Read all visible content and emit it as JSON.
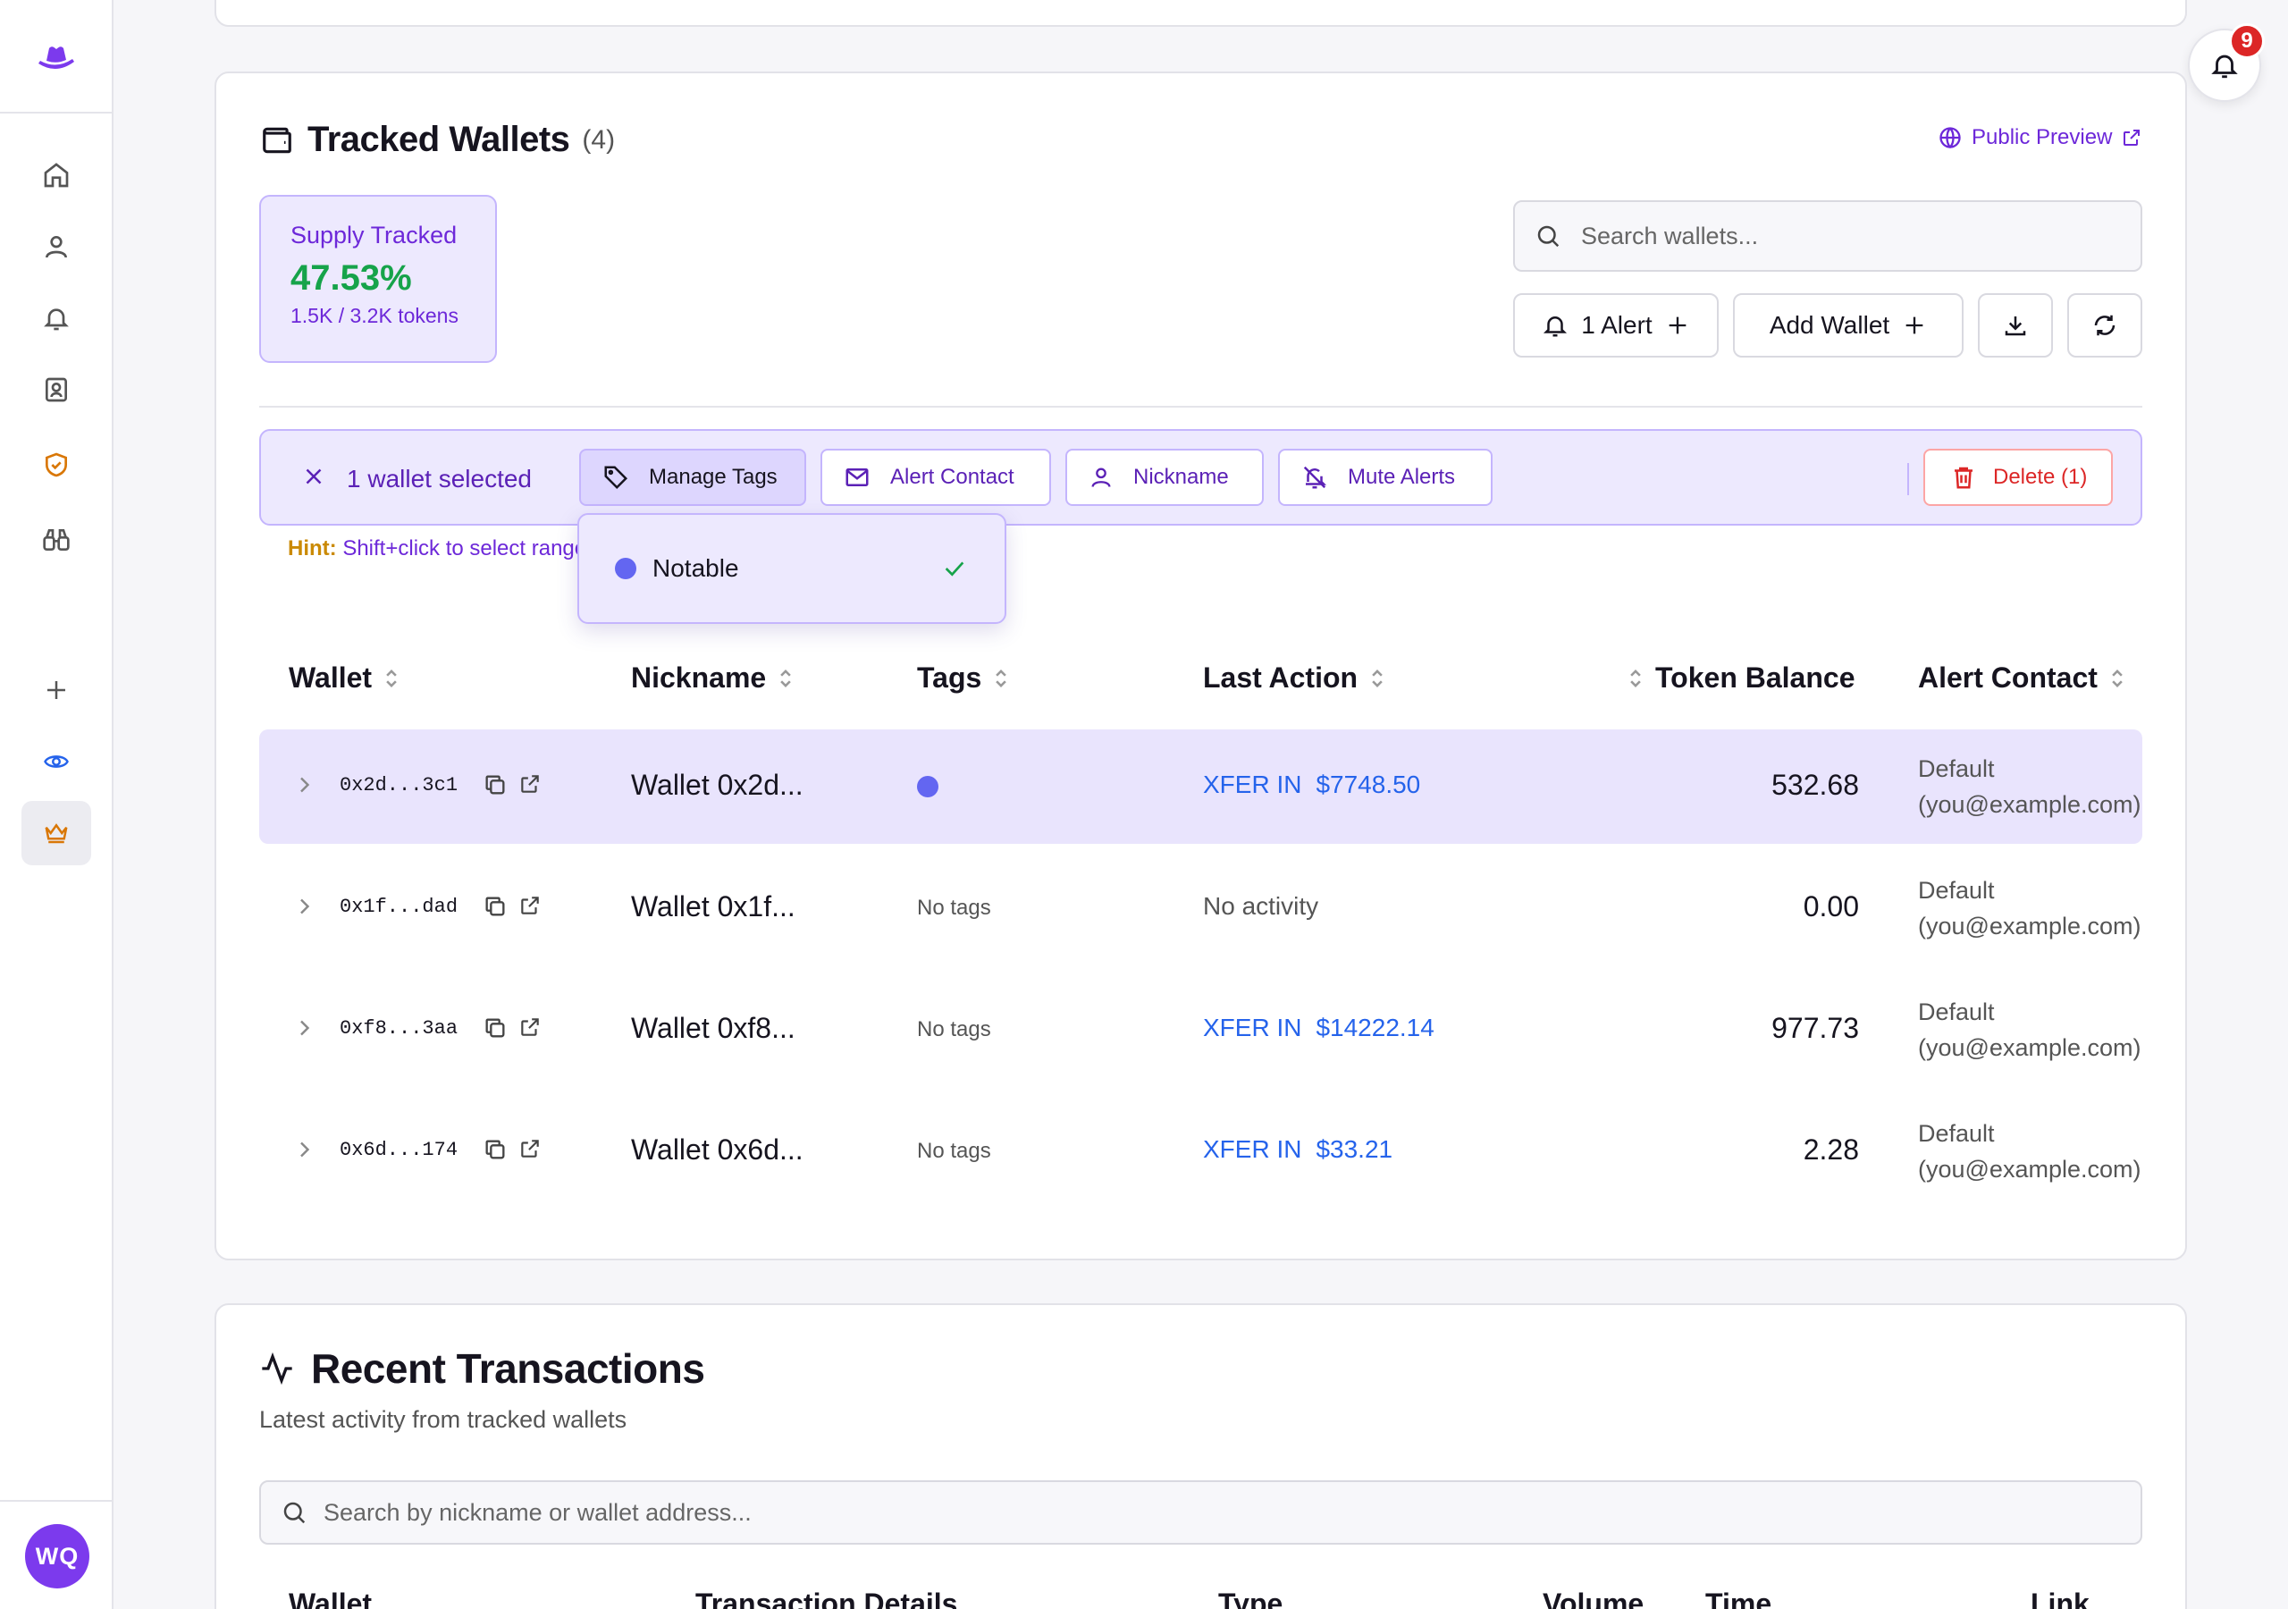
{
  "notifications": {
    "count": "9"
  },
  "user": {
    "initials": "WQ"
  },
  "wallets": {
    "title": "Tracked Wallets",
    "count": "(4)",
    "public_preview": "Public Preview",
    "supply": {
      "label": "Supply Tracked",
      "value": "47.53%",
      "detail": "1.5K / 3.2K tokens"
    },
    "search_placeholder": "Search wallets...",
    "buttons": {
      "alert": "1 Alert",
      "add_wallet": "Add Wallet"
    },
    "bulk": {
      "selected": "1 wallet selected",
      "manage_tags": "Manage Tags",
      "alert_contact": "Alert Contact",
      "nickname": "Nickname",
      "mute_alerts": "Mute Alerts",
      "delete": "Delete (1)"
    },
    "hint": {
      "key": "Hint:",
      "text": " Shift+click to select range"
    },
    "tag_menu": [
      {
        "label": "Notable",
        "checked": true,
        "color": "#6366f1"
      }
    ],
    "columns": {
      "wallet": "Wallet",
      "nickname": "Nickname",
      "tags": "Tags",
      "last_action": "Last Action",
      "token_balance": "Token Balance",
      "alert_contact": "Alert Contact"
    },
    "rows": [
      {
        "address": "0x2d...3c1",
        "nickname": "Wallet 0x2d...",
        "tags": "",
        "action_type": "XFER IN",
        "action_amount": "$7748.50",
        "balance": "532.68",
        "contact_line1": "Default",
        "contact_line2": "(you@example.com)"
      },
      {
        "address": "0x1f...dad",
        "nickname": "Wallet 0x1f...",
        "tags": "No tags",
        "no_activity": "No activity",
        "balance": "0.00",
        "contact_line1": "Default",
        "contact_line2": "(you@example.com)"
      },
      {
        "address": "0xf8...3aa",
        "nickname": "Wallet 0xf8...",
        "tags": "No tags",
        "action_type": "XFER IN",
        "action_amount": "$14222.14",
        "balance": "977.73",
        "contact_line1": "Default",
        "contact_line2": "(you@example.com)"
      },
      {
        "address": "0x6d...174",
        "nickname": "Wallet 0x6d...",
        "tags": "No tags",
        "action_type": "XFER IN",
        "action_amount": "$33.21",
        "balance": "2.28",
        "contact_line1": "Default",
        "contact_line2": "(you@example.com)"
      }
    ]
  },
  "transactions": {
    "title": "Recent Transactions",
    "subtitle": "Latest activity from tracked wallets",
    "search_placeholder": "Search by nickname or wallet address...",
    "columns": [
      "Wallet",
      "Transaction Details",
      "Type",
      "Volume",
      "Time",
      "Link"
    ]
  },
  "colors": {
    "accent": "#6d28d9",
    "accent_soft": "#ede9fe",
    "success": "#16a34a",
    "danger": "#dc2626",
    "link": "#2563eb",
    "tag": "#6366f1"
  }
}
